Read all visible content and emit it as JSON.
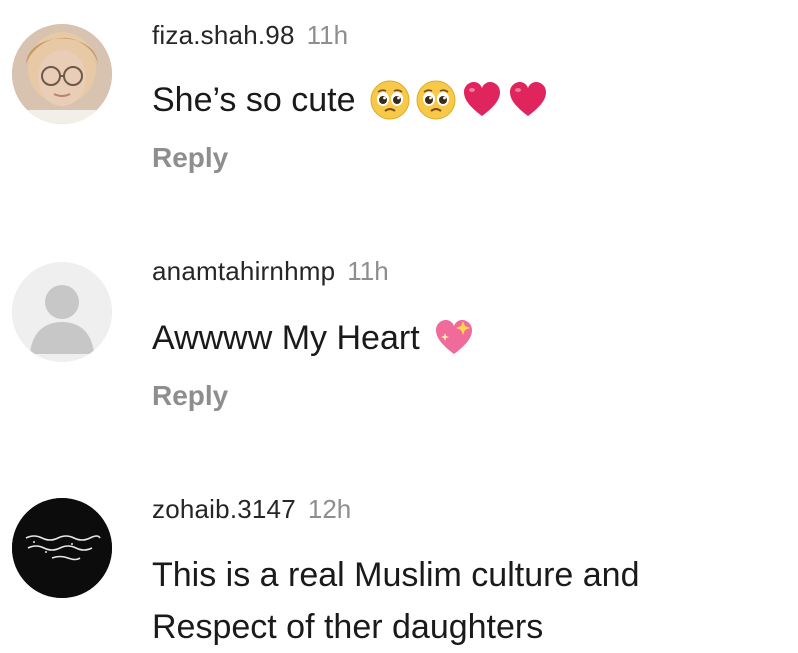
{
  "comments": [
    {
      "username": "fiza.shah.98",
      "time": "11h",
      "text": "She’s so cute",
      "emojis": [
        "pleading-face",
        "pleading-face",
        "red-heart",
        "red-heart"
      ],
      "reply_label": "Reply"
    },
    {
      "username": "anamtahirnhmp",
      "time": "11h",
      "text": "Awwww My Heart",
      "emojis": [
        "sparkling-heart"
      ],
      "reply_label": "Reply"
    },
    {
      "username": "zohaib.3147",
      "time": "12h",
      "text": "This is a real Muslim culture and Respect of ther daughters"
    }
  ],
  "colors": {
    "username": "#262626",
    "time": "#8e8e8e",
    "reply": "#8e8e8e",
    "heart": "#e0245e",
    "pink_heart": "#f06a9b"
  }
}
